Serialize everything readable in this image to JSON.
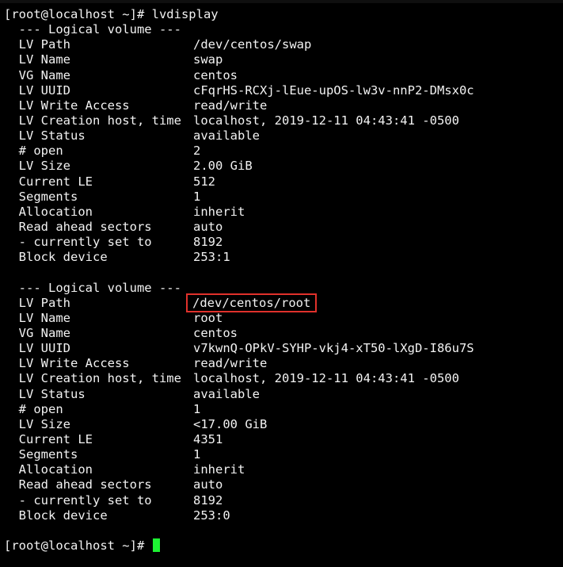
{
  "terminal": {
    "prompt": "[root@localhost ~]# ",
    "command": "lvdisplay",
    "volumes": [
      {
        "header": "  --- Logical volume ---",
        "fields": [
          {
            "key": "  LV Path",
            "value": "/dev/centos/swap"
          },
          {
            "key": "  LV Name",
            "value": "swap"
          },
          {
            "key": "  VG Name",
            "value": "centos"
          },
          {
            "key": "  LV UUID",
            "value": "cFqrHS-RCXj-lEue-upOS-lw3v-nnP2-DMsx0c"
          },
          {
            "key": "  LV Write Access",
            "value": "read/write"
          },
          {
            "key": "  LV Creation host, time",
            "value": "localhost, 2019-12-11 04:43:41 -0500"
          },
          {
            "key": "  LV Status",
            "value": "available"
          },
          {
            "key": "  # open",
            "value": "2"
          },
          {
            "key": "  LV Size",
            "value": "2.00 GiB"
          },
          {
            "key": "  Current LE",
            "value": "512"
          },
          {
            "key": "  Segments",
            "value": "1"
          },
          {
            "key": "  Allocation",
            "value": "inherit"
          },
          {
            "key": "  Read ahead sectors",
            "value": "auto"
          },
          {
            "key": "  - currently set to",
            "value": "8192"
          },
          {
            "key": "  Block device",
            "value": "253:1"
          }
        ]
      },
      {
        "header": "  --- Logical volume ---",
        "fields": [
          {
            "key": "  LV Path",
            "value": "/dev/centos/root"
          },
          {
            "key": "  LV Name",
            "value": "root"
          },
          {
            "key": "  VG Name",
            "value": "centos"
          },
          {
            "key": "  LV UUID",
            "value": "v7kwnQ-OPkV-SYHP-vkj4-xT50-lXgD-I86u7S"
          },
          {
            "key": "  LV Write Access",
            "value": "read/write"
          },
          {
            "key": "  LV Creation host, time",
            "value": "localhost, 2019-12-11 04:43:41 -0500"
          },
          {
            "key": "  LV Status",
            "value": "available"
          },
          {
            "key": "  # open",
            "value": "1"
          },
          {
            "key": "  LV Size",
            "value": "<17.00 GiB"
          },
          {
            "key": "  Current LE",
            "value": "4351"
          },
          {
            "key": "  Segments",
            "value": "1"
          },
          {
            "key": "  Allocation",
            "value": "inherit"
          },
          {
            "key": "  Read ahead sectors",
            "value": "auto"
          },
          {
            "key": "  - currently set to",
            "value": "8192"
          },
          {
            "key": "  Block device",
            "value": "253:0"
          }
        ]
      }
    ],
    "final_prompt": "[root@localhost ~]# "
  },
  "colors": {
    "background": "#000000",
    "foreground": "#f2f2f2",
    "cursor": "#1df233",
    "highlight_box": "#e0312b"
  }
}
